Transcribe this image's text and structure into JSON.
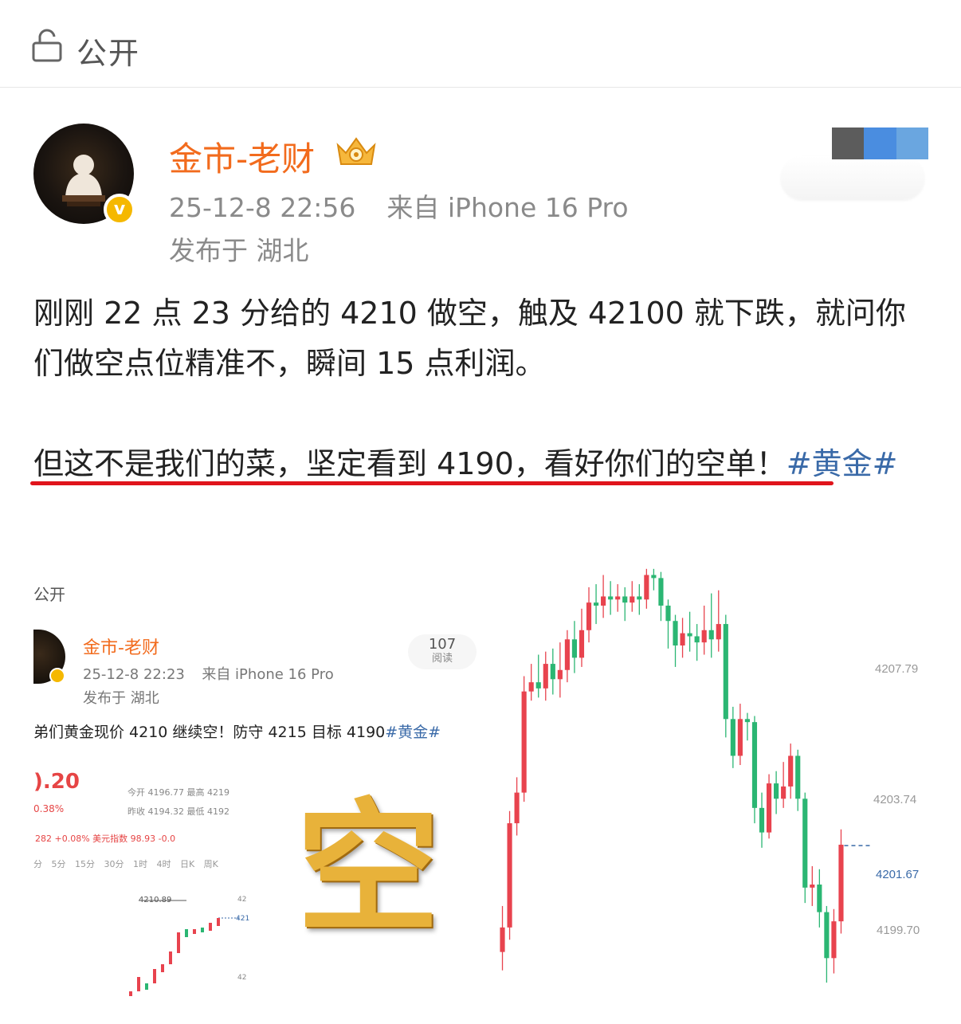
{
  "topbar": {
    "label": "公开"
  },
  "author": {
    "name": "金市-老财",
    "timestamp": "25-12-8 22:56",
    "source": "来自 iPhone 16 Pro",
    "location": "发布于 湖北",
    "verified_badge": "v"
  },
  "post": {
    "line1": "刚刚 22 点 23 分给的 4210 做空，触及 42100 就下跌，就问你们做空点位精准不，瞬间 15 点利润。",
    "line2_highlight": "但这不是我们的菜，坚定看到 4190，看好你们的空单！",
    "hashtag": "#黄金#"
  },
  "embedded": {
    "open_label": "公开",
    "name": "金市-老财",
    "timestamp": "25-12-8 22:23",
    "source": "来自 iPhone 16 Pro",
    "location": "发布于 湖北",
    "reads_count": "107",
    "reads_label": "阅读",
    "post_text": "弟们黄金现价 4210 继续空！防守 4215 目标 4190",
    "post_tag": "#黄金#",
    "quote": {
      "price": ").20",
      "pct": "0.38%",
      "row1": "今开 4196.77     最高 4219",
      "row2": "昨收 4194.32     最低 4192",
      "row3": "282 +0.08%          美元指数 98.93 -0.0",
      "tabs": "分 5分 15分 30分 1时 4时 日K 周K",
      "mini_high": "4210.89",
      "mini_right_top": "42",
      "mini_right_mid": "421",
      "mini_right_bot": "42"
    },
    "big_char": "空"
  },
  "chart_data": {
    "type": "candlestick",
    "price_labels": [
      "4207.79",
      "4203.74",
      "4201.67",
      "4199.70"
    ],
    "current_price": "4201.67",
    "up_color": "#e8434e",
    "down_color": "#2bb673",
    "ylim": [
      4196.5,
      4210.8
    ],
    "candles": [
      [
        4198.2,
        4199.0,
        4197.6,
        4199.7
      ],
      [
        4199.0,
        4202.4,
        4198.6,
        4202.8
      ],
      [
        4202.4,
        4203.4,
        4202.0,
        4203.9
      ],
      [
        4203.4,
        4206.7,
        4203.1,
        4207.2
      ],
      [
        4206.7,
        4207.0,
        4206.4,
        4207.6
      ],
      [
        4207.0,
        4206.8,
        4206.5,
        4207.9
      ],
      [
        4206.8,
        4207.6,
        4206.4,
        4208.0
      ],
      [
        4207.6,
        4207.1,
        4206.6,
        4208.1
      ],
      [
        4207.1,
        4207.4,
        4206.5,
        4208.3
      ],
      [
        4207.4,
        4208.4,
        4207.0,
        4208.7
      ],
      [
        4208.4,
        4207.8,
        4207.3,
        4209.0
      ],
      [
        4207.8,
        4208.7,
        4207.5,
        4209.4
      ],
      [
        4208.7,
        4209.6,
        4208.3,
        4210.1
      ],
      [
        4209.6,
        4209.5,
        4208.9,
        4210.2
      ],
      [
        4209.5,
        4209.8,
        4209.1,
        4210.5
      ],
      [
        4209.8,
        4209.7,
        4209.2,
        4210.3
      ],
      [
        4209.7,
        4209.8,
        4209.3,
        4210.2
      ],
      [
        4209.8,
        4209.6,
        4209.0,
        4210.1
      ],
      [
        4209.6,
        4209.8,
        4209.3,
        4210.3
      ],
      [
        4209.8,
        4209.7,
        4209.2,
        4210.2
      ],
      [
        4209.7,
        4210.5,
        4209.4,
        4210.7
      ],
      [
        4210.5,
        4210.4,
        4210.0,
        4210.7
      ],
      [
        4210.4,
        4209.5,
        4209.0,
        4210.6
      ],
      [
        4209.5,
        4209.0,
        4208.1,
        4209.7
      ],
      [
        4209.0,
        4208.2,
        4207.5,
        4209.2
      ],
      [
        4208.2,
        4208.6,
        4207.8,
        4209.1
      ],
      [
        4208.6,
        4208.5,
        4208.0,
        4209.3
      ],
      [
        4208.5,
        4208.3,
        4207.7,
        4208.9
      ],
      [
        4208.3,
        4208.7,
        4207.9,
        4209.5
      ],
      [
        4208.7,
        4208.4,
        4207.8,
        4209.9
      ],
      [
        4208.4,
        4208.9,
        4208.0,
        4210.0
      ],
      [
        4208.9,
        4205.8,
        4205.2,
        4209.2
      ],
      [
        4205.8,
        4204.6,
        4204.2,
        4206.2
      ],
      [
        4204.6,
        4205.8,
        4204.3,
        4206.3
      ],
      [
        4205.8,
        4205.7,
        4205.1,
        4206.0
      ],
      [
        4205.7,
        4202.9,
        4202.4,
        4205.9
      ],
      [
        4202.9,
        4202.1,
        4201.6,
        4203.4
      ],
      [
        4202.1,
        4203.7,
        4201.9,
        4204.0
      ],
      [
        4203.7,
        4203.2,
        4202.7,
        4204.1
      ],
      [
        4203.2,
        4203.6,
        4202.9,
        4204.4
      ],
      [
        4203.6,
        4204.6,
        4203.2,
        4205.0
      ],
      [
        4204.6,
        4203.2,
        4202.8,
        4204.8
      ],
      [
        4203.2,
        4200.3,
        4199.8,
        4203.4
      ],
      [
        4200.3,
        4200.4,
        4199.7,
        4201.0
      ],
      [
        4200.4,
        4199.5,
        4199.0,
        4200.9
      ],
      [
        4199.5,
        4198.0,
        4197.2,
        4199.7
      ],
      [
        4198.0,
        4199.2,
        4197.5,
        4199.6
      ],
      [
        4199.2,
        4201.7,
        4198.8,
        4202.2
      ]
    ]
  }
}
